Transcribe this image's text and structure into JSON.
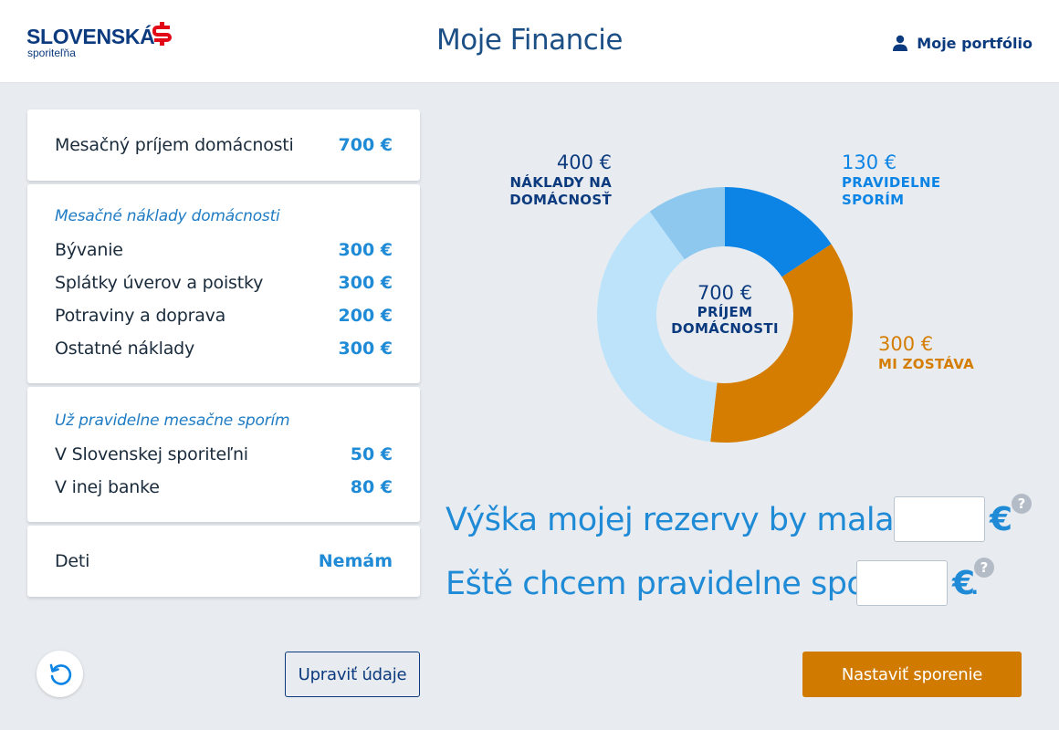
{
  "header": {
    "logo_text": "SLOVENSKÁ",
    "logo_sub": "sporiteľňa",
    "title": "Moje Financie",
    "portfolio_label": "Moje portfólio"
  },
  "income_card": {
    "label": "Mesačný príjem domácnosti",
    "value": "700 €"
  },
  "costs_card": {
    "title": "Mesačné náklady domácnosti",
    "items": [
      {
        "label": "Bývanie",
        "value": "300 €"
      },
      {
        "label": "Splátky úverov a poistky",
        "value": "300 €"
      },
      {
        "label": "Potraviny a doprava",
        "value": "200 €"
      },
      {
        "label": "Ostatné náklady",
        "value": "300 €"
      }
    ]
  },
  "savings_card": {
    "title": "Už pravidelne mesačne sporím",
    "items": [
      {
        "label": "V Slovenskej sporiteľni",
        "value": "50 €"
      },
      {
        "label": "V inej banke",
        "value": "80 €"
      }
    ]
  },
  "children_card": {
    "label": "Deti",
    "value": "Nemám"
  },
  "chart_data": {
    "type": "pie",
    "title": "",
    "center_amount": "700 €",
    "center_label_line1": "PRÍJEM",
    "center_label_line2": "DOMÁCNOSTI",
    "slices": [
      {
        "key": "saving",
        "amount": "130 €",
        "label_line1": "PRAVIDELNE",
        "label_line2": "SPORÍM",
        "value": 130,
        "color": "#0b84e6"
      },
      {
        "key": "remaining",
        "amount": "300 €",
        "label_line1": "MI ZOSTÁVA",
        "label_line2": "",
        "value": 300,
        "color": "#d47d00"
      },
      {
        "key": "costs",
        "amount": "400 €",
        "label_line1": "NÁKLADY NA",
        "label_line2": "DOMÁCNOSŤ",
        "value": 400,
        "color": "#bde3fb",
        "secondary_color": "#8ec8ee"
      }
    ],
    "label_colors": {
      "saving": "#0b84e6",
      "remaining": "#d47d00",
      "costs": "#0b3a7e",
      "center": "#0b3a7e"
    }
  },
  "reserve": {
    "sentence": "Výška mojej rezervy by mala byť",
    "currency": "€",
    "input_value": "",
    "help": "?"
  },
  "save_more": {
    "sentence": "Eště chcem pravidelne sporiť",
    "currency": "€",
    "trailing": ".",
    "input_value": "",
    "help": "?"
  },
  "footer": {
    "edit_label": "Upraviť údaje",
    "primary_label": "Nastaviť sporenie"
  },
  "colors": {
    "brand_navy": "#0b3a7e",
    "accent_blue": "#1f8ad6",
    "accent_orange": "#d07b00",
    "logo_red": "#e20a16",
    "background": "#e8ecf0"
  }
}
